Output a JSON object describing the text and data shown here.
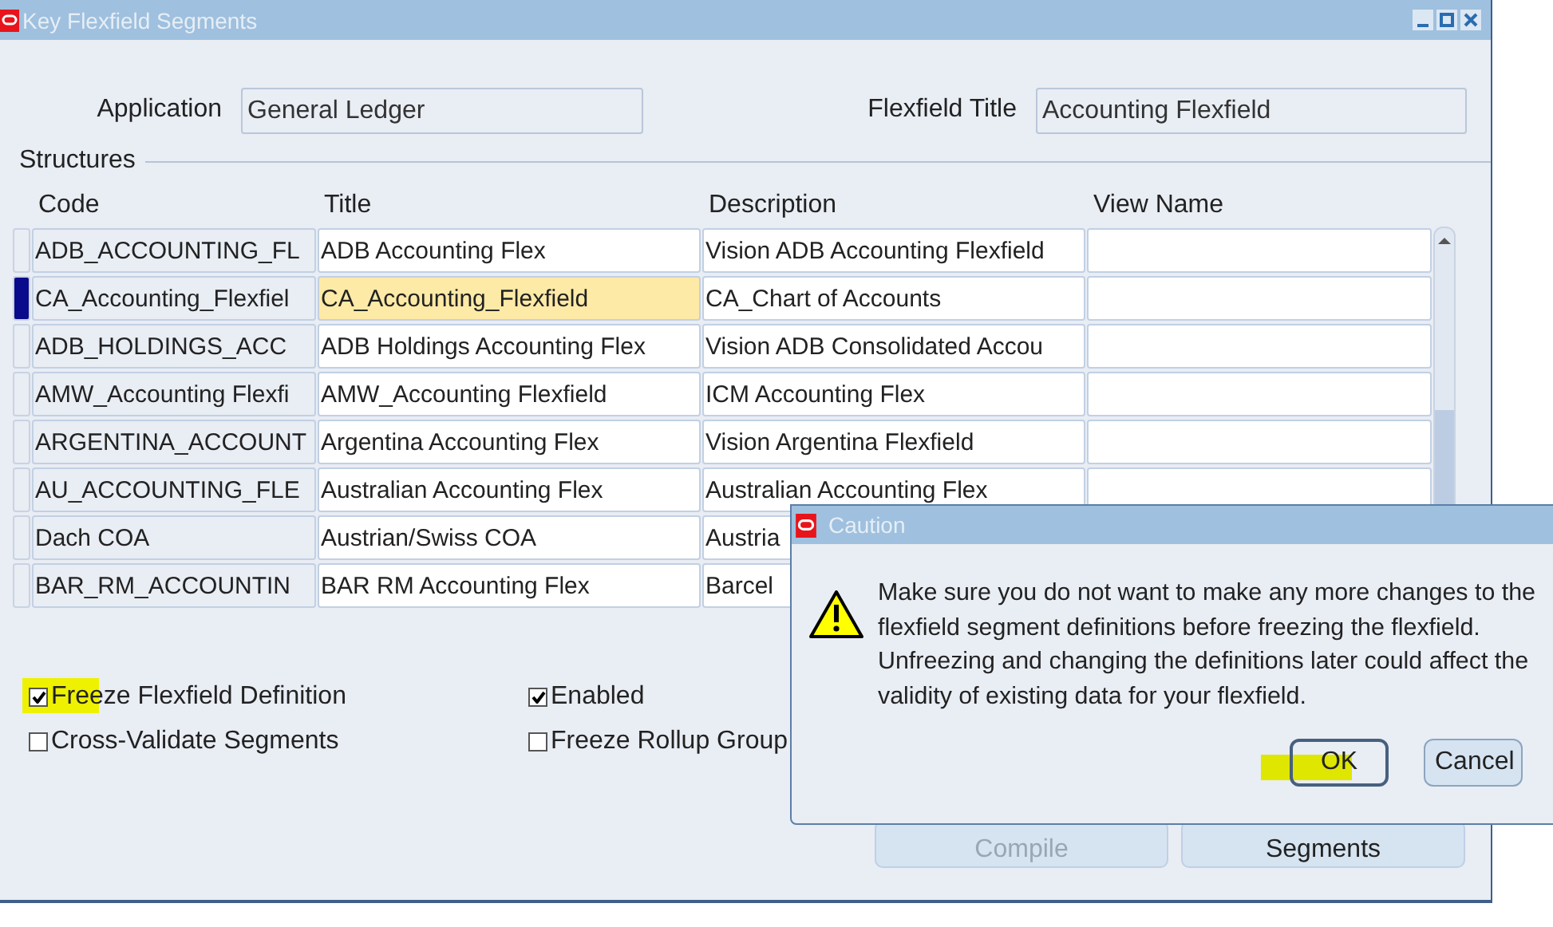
{
  "window": {
    "title": "Key Flexfield Segments"
  },
  "header": {
    "application_label": "Application",
    "application": "General Ledger",
    "flexfield_title_label": "Flexfield Title",
    "flexfield_title": "Accounting Flexfield"
  },
  "structures": {
    "label": "Structures",
    "columns": [
      "Code",
      "Title",
      "Description",
      "View Name"
    ],
    "rows": [
      {
        "code": "ADB_ACCOUNTING_FL",
        "title": "ADB Accounting Flex",
        "description": "Vision ADB Accounting Flexfield",
        "selected": false
      },
      {
        "code": "CA_Accounting_Flexfiel",
        "title": "CA_Accounting_Flexfield",
        "description": "CA_Chart of Accounts",
        "selected": true
      },
      {
        "code": "ADB_HOLDINGS_ACC",
        "title": "ADB Holdings Accounting Flex",
        "description": "Vision ADB Consolidated Accou",
        "selected": false
      },
      {
        "code": "AMW_Accounting Flexfi",
        "title": "AMW_Accounting Flexfield",
        "description": "ICM Accounting Flex",
        "selected": false
      },
      {
        "code": "ARGENTINA_ACCOUNT",
        "title": "Argentina Accounting Flex",
        "description": "Vision Argentina Flexfield",
        "selected": false
      },
      {
        "code": "AU_ACCOUNTING_FLE",
        "title": "Australian Accounting Flex",
        "description": "Australian Accounting Flex",
        "selected": false
      },
      {
        "code": "Dach COA",
        "title": "Austrian/Swiss COA",
        "description": "Austria",
        "selected": false,
        "obscured": true
      },
      {
        "code": "BAR_RM_ACCOUNTIN",
        "title": "BAR RM Accounting Flex",
        "description": "Barcel",
        "selected": false,
        "obscured": true
      }
    ]
  },
  "options": [
    {
      "label": "Freeze Flexfield Definition",
      "checked": true,
      "highlighted": true
    },
    {
      "label": "Enabled",
      "checked": true,
      "highlighted": false
    },
    {
      "label": "Cross-Validate Segments",
      "checked": false,
      "highlighted": false
    },
    {
      "label": "Freeze Rollup Group",
      "checked": false,
      "highlighted": false
    }
  ],
  "buttons": [
    {
      "label": "Compile",
      "disabled": true
    },
    {
      "label": "Segments",
      "disabled": false
    }
  ],
  "dialog": {
    "title": "Caution",
    "message": "Make sure you do not want to make any more changes to the flexfield segment definitions before freezing the flexfield. Unfreezing and changing the definitions later could affect the validity of existing data for your flexfield.",
    "buttons": [
      {
        "label": "OK",
        "default": true,
        "highlighted": true
      },
      {
        "label": "Cancel",
        "default": false,
        "highlighted": false
      }
    ]
  }
}
